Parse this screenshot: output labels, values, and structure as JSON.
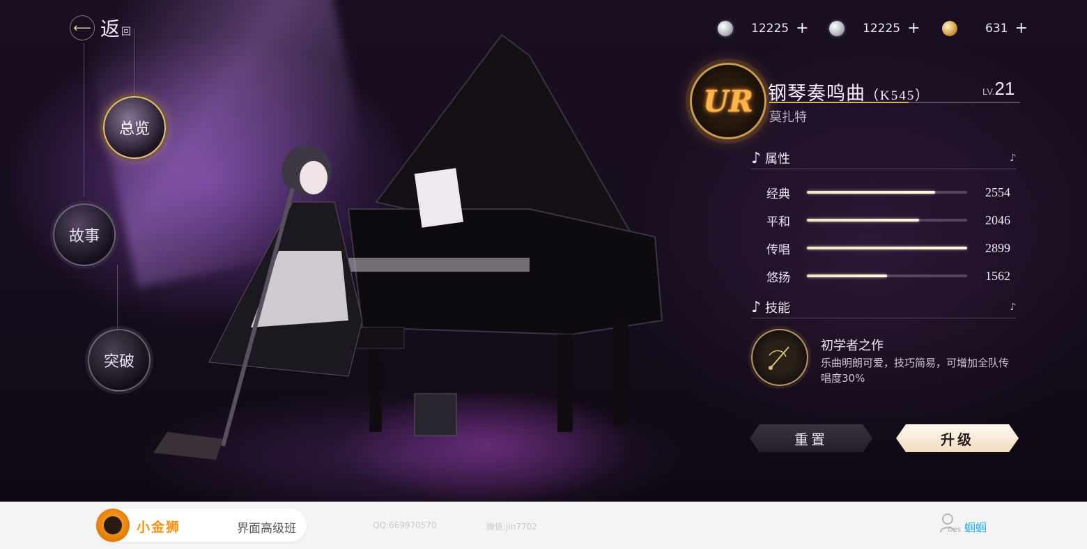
{
  "topbar": {
    "back_label": "返",
    "back_sub": "回",
    "currencies": [
      {
        "icon": "silver-coin-icon",
        "value": "12225",
        "plus": "+"
      },
      {
        "icon": "silver-coin-icon",
        "value": "12225",
        "plus": "+"
      },
      {
        "icon": "moon-crystal-icon",
        "value": "631",
        "plus": "+"
      }
    ]
  },
  "nav": {
    "items": [
      {
        "label": "总览",
        "active": true
      },
      {
        "label": "故事",
        "active": false
      },
      {
        "label": "突破",
        "active": false
      }
    ]
  },
  "card": {
    "rarity": "UR",
    "title": "钢琴奏鸣曲",
    "title_suffix": "（K545）",
    "level_label": "LV.",
    "level": "21",
    "author": "莫扎特"
  },
  "attributes": {
    "heading": "属性",
    "stats": [
      {
        "label": "经典",
        "value": "2554",
        "fill": 0.8
      },
      {
        "label": "平和",
        "value": "2046",
        "fill": 0.7
      },
      {
        "label": "传唱",
        "value": "2899",
        "fill": 1.0
      },
      {
        "label": "悠扬",
        "value": "1562",
        "fill": 0.5
      }
    ]
  },
  "skill": {
    "heading": "技能",
    "name": "初学者之作",
    "description": "乐曲明朗可爱，技巧简易，可增加全队传唱度30%"
  },
  "buttons": {
    "reset": "重置",
    "upgrade": "升级"
  },
  "footer": {
    "brand": "小金狮",
    "course": "界面高级班",
    "qq": "QQ:669970570",
    "wechat": "微信:jin7702",
    "user_sub": "Des",
    "username": "蝈蝈"
  },
  "colors": {
    "accent_gold": "#d8b36a",
    "rarity_orange": "#ffb44a",
    "bg_purple": "#1a0f22",
    "brand_orange": "#f29116",
    "username_blue": "#29a8e0"
  }
}
